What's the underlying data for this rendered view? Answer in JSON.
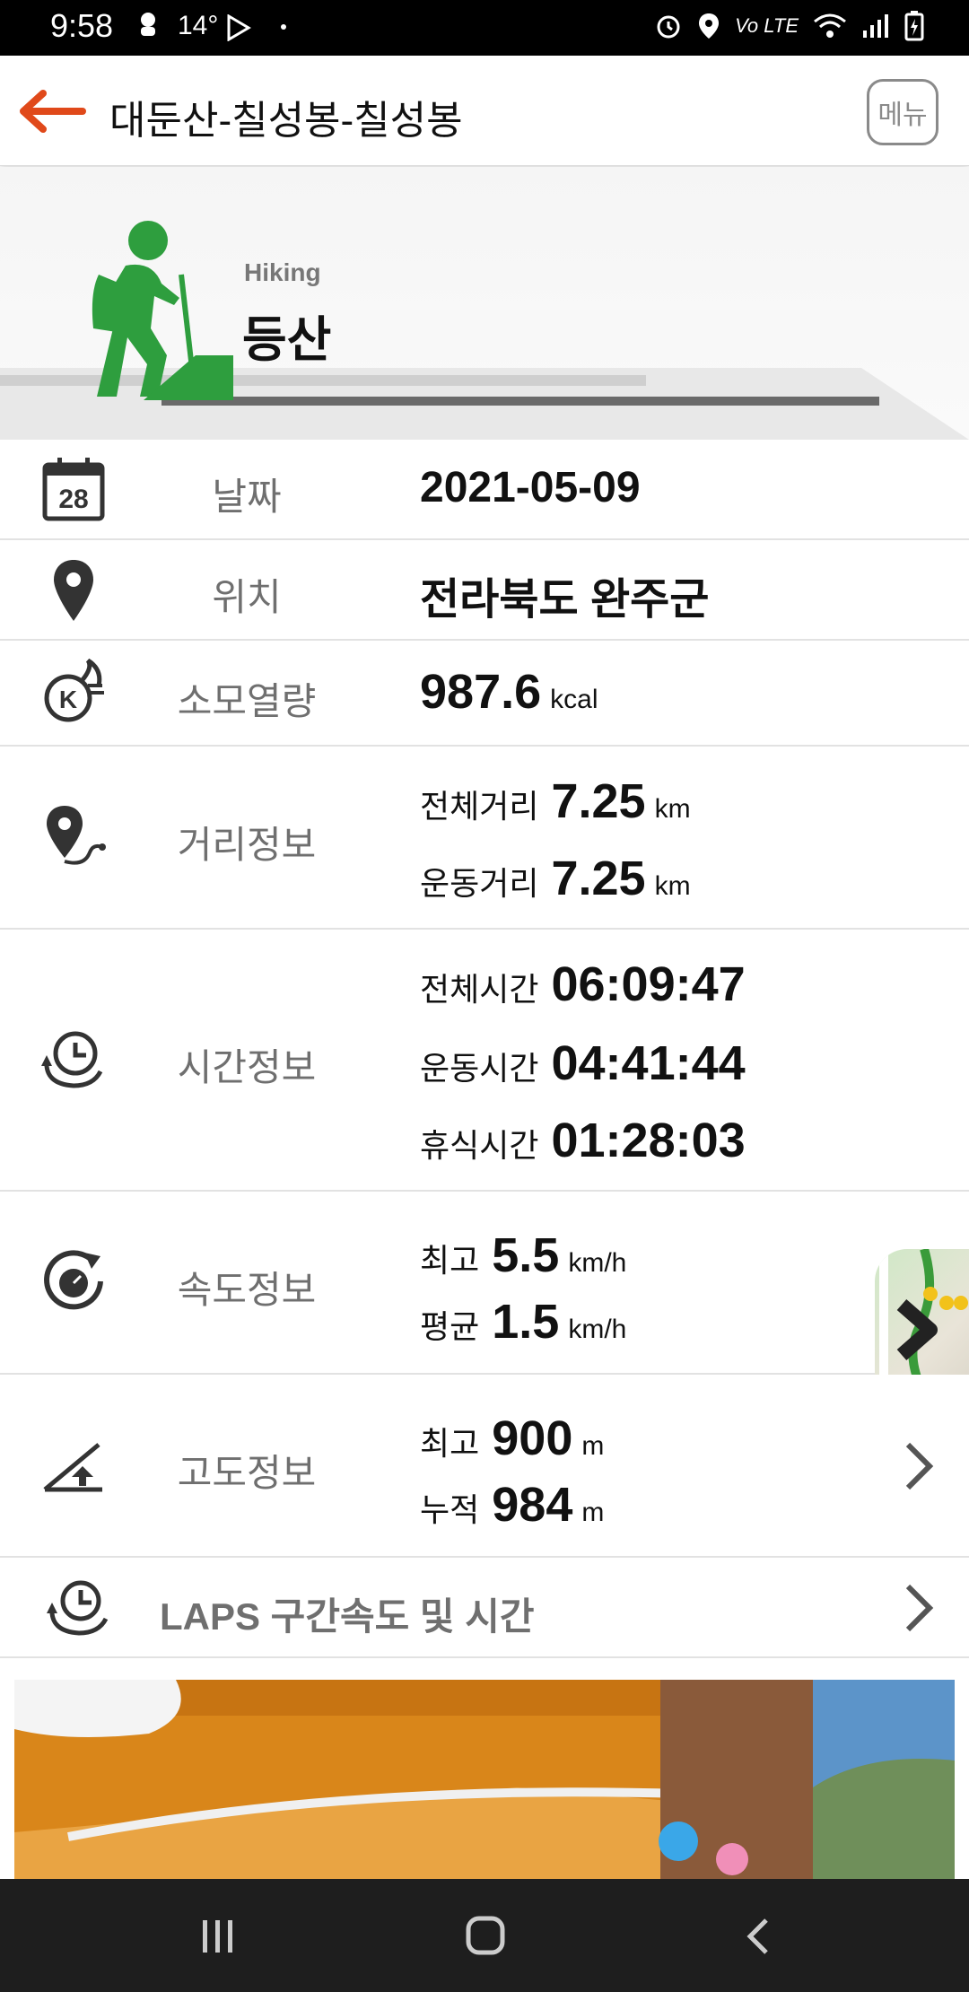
{
  "status_bar": {
    "time": "9:58",
    "temperature": "14°",
    "network_label": "Vo LTE"
  },
  "app_bar": {
    "title": "대둔산-칠성봉-칠성봉",
    "menu_label": "메뉴",
    "accent_color": "#e0491a"
  },
  "activity": {
    "type_en": "Hiking",
    "type_ko": "등산",
    "icon_color": "#2e9e3e"
  },
  "rows": {
    "date": {
      "label": "날짜",
      "value": "2021-05-09",
      "calendar_day": "28"
    },
    "location": {
      "label": "위치",
      "value": "전라북도 완주군"
    },
    "calories": {
      "label": "소모열량",
      "value": "987.6",
      "unit": "kcal"
    },
    "distance": {
      "label": "거리정보",
      "total_label": "전체거리",
      "total_value": "7.25",
      "total_unit": "km",
      "moving_label": "운동거리",
      "moving_value": "7.25",
      "moving_unit": "km"
    },
    "time": {
      "label": "시간정보",
      "total_label": "전체시간",
      "total_value": "06:09:47",
      "moving_label": "운동시간",
      "moving_value": "04:41:44",
      "rest_label": "휴식시간",
      "rest_value": "01:28:03"
    },
    "speed": {
      "label": "속도정보",
      "max_label": "최고",
      "max_value": "5.5",
      "max_unit": "km/h",
      "avg_label": "평균",
      "avg_value": "1.5",
      "avg_unit": "km/h"
    },
    "altitude": {
      "label": "고도정보",
      "max_label": "최고",
      "max_value": "900",
      "max_unit": "m",
      "cum_label": "누적",
      "cum_value": "984",
      "cum_unit": "m"
    },
    "laps": {
      "label": "LAPS 구간속도 및 시간"
    }
  },
  "icons": {
    "back": "arrow-left-icon",
    "hiker": "hiker-icon",
    "calendar": "calendar-icon",
    "location": "location-pin-icon",
    "calories": "flame-k-icon",
    "distance": "route-pin-icon",
    "time": "clock-refresh-icon",
    "speed": "speedometer-icon",
    "altitude": "incline-icon",
    "laps": "lap-clock-icon"
  }
}
